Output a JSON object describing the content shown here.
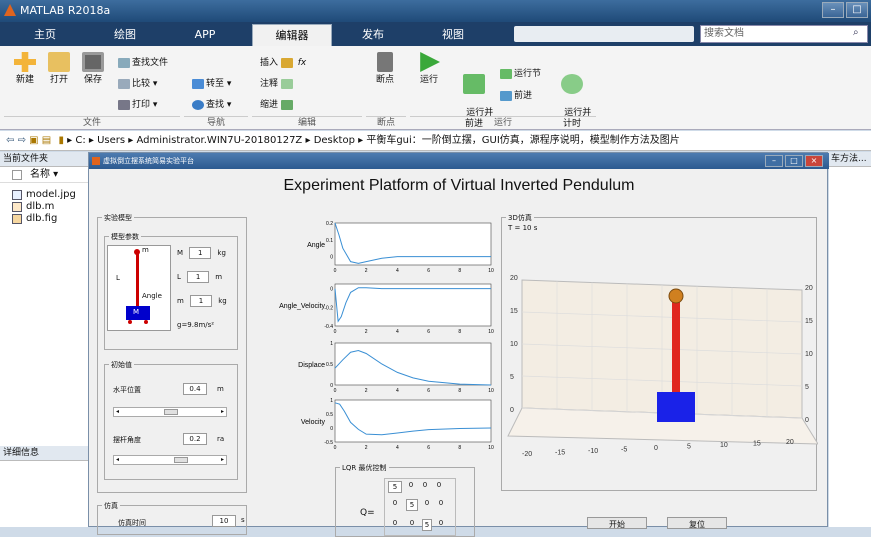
{
  "window": {
    "title": "MATLAB R2018a",
    "min": "–",
    "max": "□"
  },
  "tabs": [
    "主页",
    "绘图",
    "APP",
    "编辑器",
    "发布",
    "视图"
  ],
  "active_tab": "编辑器",
  "search_placeholder": "搜索文档",
  "toolstrip": {
    "new": "新建",
    "open": "打开",
    "save": "保存",
    "find_files": "查找文件",
    "compare": "比较",
    "print": "打印",
    "goto": "转至",
    "find": "查找",
    "insert": "插入",
    "fx": "fx",
    "comment": "注释",
    "indent": "缩进",
    "breakpoints": "断点",
    "run": "运行",
    "run_advance": "运行并\n前进",
    "run_section": "运行节",
    "advance": "前进",
    "run_time": "运行并\n计时",
    "groups": {
      "file": "文件",
      "navigate": "导航",
      "edit": "编辑",
      "breakpoints": "断点",
      "run": "运行"
    }
  },
  "address": {
    "crumbs": [
      "C:",
      "Users",
      "Administrator.WIN7U-20180127Z",
      "Desktop",
      "平衡车gui：一阶倒立摆，GUI仿真，源程序说明，模型制作方法及图片"
    ]
  },
  "current_folder": {
    "title": "当前文件夹",
    "name_col": "名称 ▾",
    "files": [
      "model.jpg",
      "dlb.m",
      "dlb.fig"
    ],
    "details": "详细信息"
  },
  "right_fragment": "车方法...",
  "figure": {
    "title": "虚拟倒立摆系统简易实验平台",
    "heading": "Experiment Platform of Virtual Inverted Pendulum",
    "model_panel": "实验模型",
    "params_panel": "模型参数",
    "params": [
      {
        "label": "M",
        "value": "1",
        "unit": "kg"
      },
      {
        "label": "L",
        "value": "1",
        "unit": "m"
      },
      {
        "label": "m",
        "value": "1",
        "unit": "kg"
      }
    ],
    "gravity": "g=9.8m/s²",
    "diagram": {
      "m": "m",
      "L": "L",
      "angle": "Angle",
      "M": "M"
    },
    "init_panel": "初始值",
    "pos_label": "水平位置",
    "pos_value": "0.4",
    "pos_unit": "m",
    "angle_label": "摆杆角度",
    "angle_value": "0.2",
    "angle_unit": "ra",
    "sim_panel": "仿真",
    "sim_time_label": "仿真时间",
    "sim_time_value": "10",
    "sim_time_unit": "s",
    "lqr_panel": "LQR 最优控制",
    "q_label": "Q=",
    "q_matrix": [
      [
        "5",
        "0",
        "0",
        "0"
      ],
      [
        "0",
        "5",
        "0",
        "0"
      ],
      [
        "0",
        "0",
        "5",
        "0"
      ]
    ],
    "view3d_panel": "3D仿真",
    "time_text": "T = 10 s",
    "buttons": [
      "开始",
      "复位"
    ]
  },
  "chart_data": [
    {
      "type": "line",
      "ylabel": "Angle",
      "x": [
        0,
        0.25,
        0.5,
        1,
        1.5,
        2,
        3,
        4,
        6,
        8,
        10
      ],
      "y": [
        0.2,
        0.13,
        0.05,
        -0.03,
        -0.04,
        -0.03,
        -0.01,
        0,
        0,
        0,
        0
      ],
      "ylim": [
        -0.05,
        0.2
      ],
      "yticks": [
        "0.2",
        "0.1",
        "0"
      ],
      "xticks": [
        "0",
        "2",
        "4",
        "6",
        "8",
        "10"
      ]
    },
    {
      "type": "line",
      "ylabel": "Angle_Velocity",
      "x": [
        0,
        0.2,
        0.4,
        0.7,
        1,
        1.5,
        2,
        3,
        4,
        6,
        10
      ],
      "y": [
        0,
        -0.35,
        -0.3,
        -0.15,
        -0.04,
        0.01,
        0.01,
        0,
        0,
        0,
        0
      ],
      "ylim": [
        -0.4,
        0.05
      ],
      "yticks": [
        "0",
        "-0.2",
        "-0.4"
      ],
      "xticks": [
        "0",
        "2",
        "4",
        "6",
        "8",
        "10"
      ]
    },
    {
      "type": "line",
      "ylabel": "Displace",
      "x": [
        0,
        0.5,
        1,
        1.5,
        2,
        3,
        4,
        5,
        6,
        8,
        10
      ],
      "y": [
        0.4,
        0.6,
        0.78,
        0.82,
        0.75,
        0.5,
        0.3,
        0.17,
        0.09,
        0.02,
        0
      ],
      "ylim": [
        0,
        1
      ],
      "yticks": [
        "1",
        "0.5",
        "0"
      ],
      "xticks": [
        "0",
        "2",
        "4",
        "6",
        "8",
        "10"
      ]
    },
    {
      "type": "line",
      "ylabel": "Velocity",
      "x": [
        0,
        0.3,
        0.6,
        1,
        1.5,
        2,
        3,
        4,
        5,
        6,
        8,
        10
      ],
      "y": [
        0.9,
        0.85,
        0.6,
        0.2,
        -0.05,
        -0.22,
        -0.24,
        -0.18,
        -0.11,
        -0.06,
        -0.02,
        0
      ],
      "ylim": [
        -0.5,
        1
      ],
      "yticks": [
        "1",
        "0.5",
        "0",
        "-0.5"
      ],
      "xticks": [
        "0",
        "2",
        "4",
        "6",
        "8",
        "10"
      ]
    },
    {
      "type": "3d",
      "title": "3D仿真",
      "zticks": [
        "0",
        "5",
        "10",
        "15",
        "20"
      ],
      "xticks": [
        "-20",
        "-15",
        "-10",
        "-5",
        "0",
        "5",
        "10",
        "15",
        "20"
      ]
    }
  ]
}
